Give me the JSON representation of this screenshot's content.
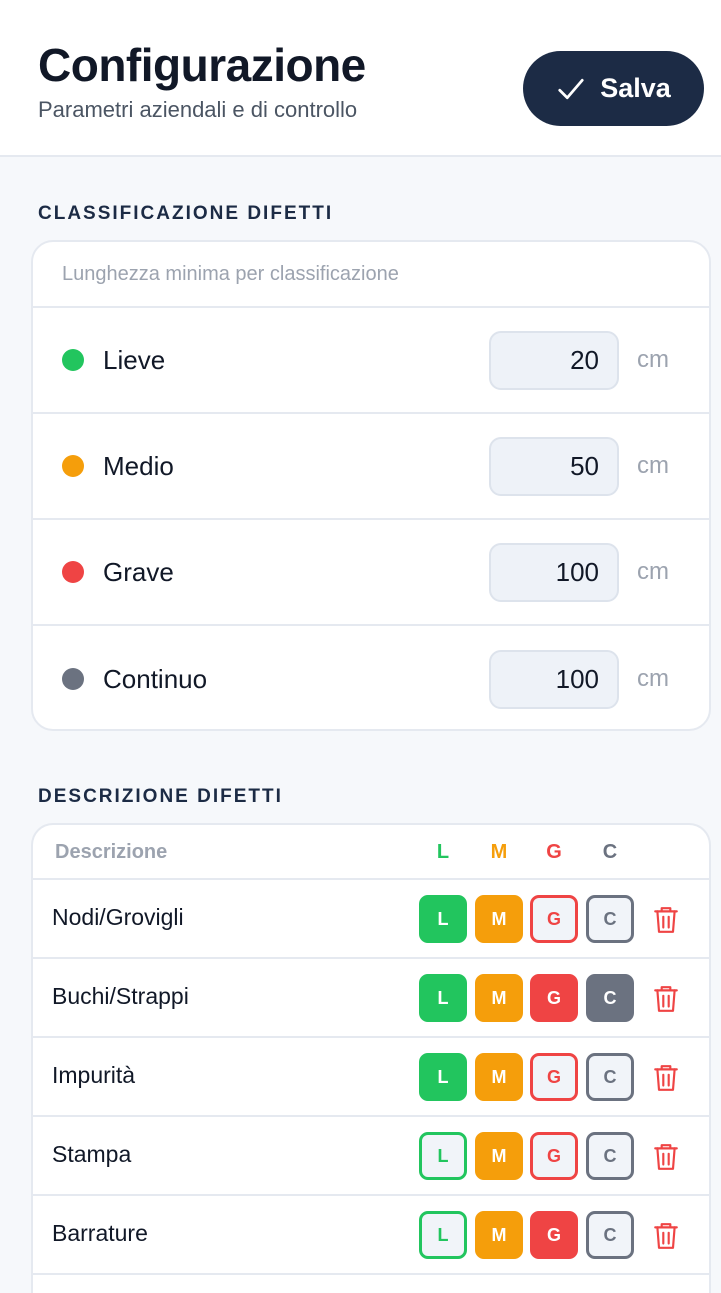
{
  "header": {
    "title": "Configurazione",
    "subtitle": "Parametri aziendali e di controllo",
    "save_label": "Salva"
  },
  "classification": {
    "section_title": "CLASSIFICAZIONE DIFETTI",
    "hint": "Lunghezza minima per classificazione",
    "rows": [
      {
        "label": "Lieve",
        "value": "20",
        "unit": "cm",
        "color": "#22c55e"
      },
      {
        "label": "Medio",
        "value": "50",
        "unit": "cm",
        "color": "#f59e0b"
      },
      {
        "label": "Grave",
        "value": "100",
        "unit": "cm",
        "color": "#ef4444"
      },
      {
        "label": "Continuo",
        "value": "100",
        "unit": "cm",
        "color": "#6b7280"
      }
    ]
  },
  "defects": {
    "section_title": "DESCRIZIONE DIFETTI",
    "col_description": "Descrizione",
    "columns": [
      {
        "letter": "L",
        "color": "#22c55e"
      },
      {
        "letter": "M",
        "color": "#f59e0b"
      },
      {
        "letter": "G",
        "color": "#ef4444"
      },
      {
        "letter": "C",
        "color": "#6b7280"
      }
    ],
    "rows": [
      {
        "label": "Nodi/Grovigli",
        "active": [
          true,
          true,
          false,
          false
        ]
      },
      {
        "label": "Buchi/Strappi",
        "active": [
          true,
          true,
          true,
          true
        ]
      },
      {
        "label": "Impurità",
        "active": [
          true,
          true,
          false,
          false
        ]
      },
      {
        "label": "Stampa",
        "active": [
          false,
          true,
          false,
          false
        ]
      },
      {
        "label": "Barrature",
        "active": [
          false,
          true,
          true,
          false
        ]
      }
    ]
  }
}
